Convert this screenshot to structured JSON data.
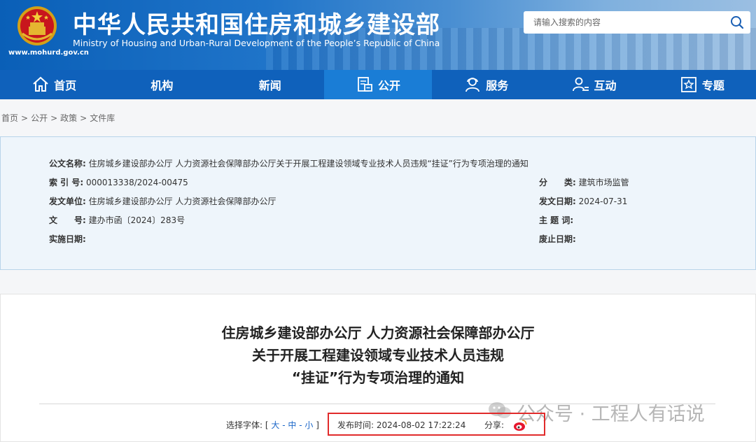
{
  "header": {
    "title": "中华人民共和国住房和城乡建设部",
    "subtitle": "Ministry of Housing and Urban-Rural Development of the People’s Republic of China",
    "url": "www.mohurd.gov.cn",
    "search_placeholder": "请输入搜索的内容"
  },
  "nav": {
    "items": [
      {
        "label": "首页",
        "icon": "home-icon"
      },
      {
        "label": "机构"
      },
      {
        "label": "新闻"
      },
      {
        "label": "公开",
        "icon": "document-icon",
        "active": true
      },
      {
        "label": "服务",
        "icon": "service-icon"
      },
      {
        "label": "互动",
        "icon": "user-interaction-icon"
      },
      {
        "label": "专题",
        "icon": "star-topic-icon"
      }
    ]
  },
  "breadcrumb": [
    "首页",
    "公开",
    "政策",
    "文件库"
  ],
  "breadcrumb_separator": ">",
  "info": {
    "name_label": "公文名称:",
    "name_value": "住房城乡建设部办公厅    人力资源社会保障部办公厅关于开展工程建设领域专业技术人员违规“挂证”行为专项治理的通知",
    "index_label": "索 引 号:",
    "index_value": "000013338/2024-00475",
    "category_label": "分　　类:",
    "category_value": "建筑市场监管",
    "issuer_label": "发文单位:",
    "issuer_value": "住房城乡建设部办公厅    人力资源社会保障部办公厅",
    "date_label": "发文日期:",
    "date_value": "2024-07-31",
    "docno_label": "文　　号:",
    "docno_value": "建办市函〔2024〕283号",
    "subject_label": "主 题 词:",
    "subject_value": "",
    "effective_label": "实施日期:",
    "effective_value": "",
    "expiry_label": "废止日期:",
    "expiry_value": ""
  },
  "article": {
    "title_line1": "住房城乡建设部办公厅    人力资源社会保障部办公厅",
    "title_line2": "关于开展工程建设领域专业技术人员违规",
    "title_line3": "“挂证”行为专项治理的通知",
    "font_select_label": "选择字体:",
    "font_bracket_open": "[",
    "font_large": "大",
    "font_sep1": "-",
    "font_medium": "中",
    "font_sep2": "-",
    "font_small": "小",
    "font_bracket_close": "]",
    "publish_label": "发布时间:",
    "publish_time": "2024-08-02 17:22:24",
    "share_label": "分享:"
  },
  "watermark": "公众号 · 工程人有话说",
  "colors": {
    "nav_bg": "#0f61bb",
    "nav_active": "#1a7dd6",
    "info_bg": "#eef5fb",
    "highlight": "#e12b2b",
    "link": "#1a66c8"
  }
}
